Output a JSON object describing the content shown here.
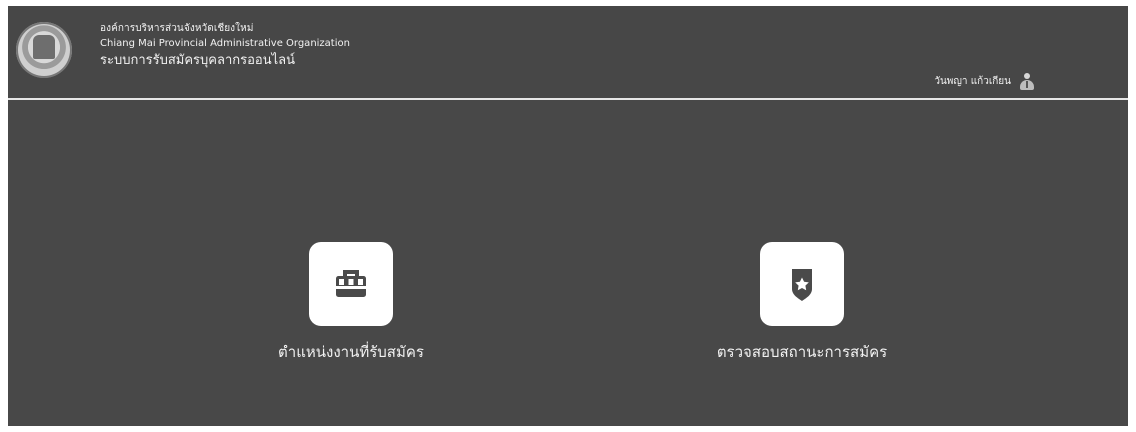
{
  "header": {
    "organization_thai": "องค์การบริหารส่วนจังหวัดเชียงใหม่",
    "organization_en": "Chiang Mai Provincial Administrative Organization",
    "system_name": "ระบบการรับสมัครบุคลากรออนไลน์",
    "user_name": "วันพญา แก้วเกียน",
    "user_icon": "user-icon",
    "logo_icon": "organization-seal-icon"
  },
  "menu": {
    "items": [
      {
        "label": "ตำแหน่งงานที่รับสมัคร",
        "icon": "briefcase-icon"
      },
      {
        "label": "ตรวจสอบสถานะการสมัคร",
        "icon": "shield-star-icon"
      }
    ]
  },
  "colors": {
    "header_background": "#474747",
    "page_background": "#484848",
    "icon_background": "#ffffff",
    "text_color": "#f2f2f2",
    "divider": "#e6e6e6"
  }
}
